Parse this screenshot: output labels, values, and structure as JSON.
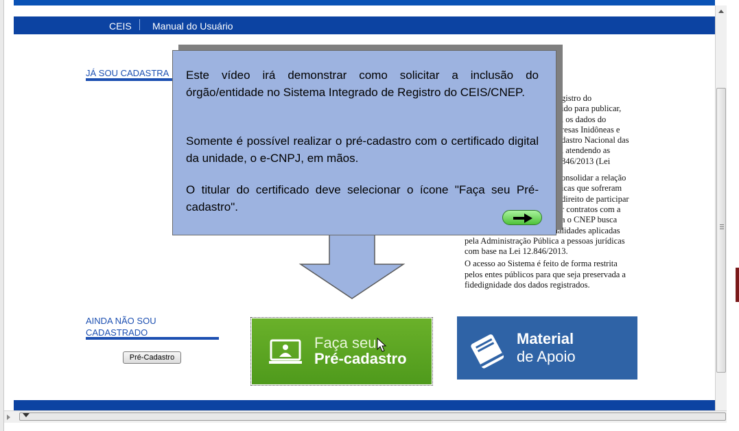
{
  "nav": {
    "item1": "CEIS",
    "item2": "Manual do Usuário"
  },
  "left": {
    "heading_registered": "JÁ SOU CADASTRA",
    "heading_not_registered_line1": "AINDA NÃO SOU",
    "heading_not_registered_line2": "CADASTRADO",
    "pre_cadastro_button": "Pré-Cadastro"
  },
  "right_column_lines": [
    "gistro do",
    "ido para publicar,",
    ", os dados do",
    "resas Inidôneas e",
    "dastro Nacional das",
    ", atendendo as",
    "846/2013 (Lei",
    "",
    "onsolidar a relação",
    "icas que sofreram",
    "direito de participar",
    "r contratos com a",
    "a o CNEP busca",
    "consolidar a relação de penalidades aplicadas",
    "pela Administração Pública a pessoas jurídicas",
    "com base na Lei 12.846/2013.",
    "O acesso ao Sistema é feito de forma restrita",
    "pelos entes públicos para que seja preservada a",
    "fidedignidade dos dados registrados."
  ],
  "tooltip": {
    "paragraph1": "Este vídeo irá demonstrar como solicitar a inclusão do órgão/entidade no Sistema Integrado de Registro do CEIS/CNEP.",
    "paragraph2": "Somente é possível realizar o pré-cadastro com o certificado digital da unidade, o e-CNPJ, em mãos.",
    "paragraph3": "O titular do certificado deve selecionar o ícone \"Faça seu Pré-cadastro\"."
  },
  "faca_button": {
    "line1": "Faça seu",
    "line2": "Pré-cadastro"
  },
  "material_button": {
    "line1": "Material",
    "line2": "de Apoio"
  },
  "icons": [
    "monitor-person-icon",
    "book-icon",
    "right-arrow-icon",
    "mouse-cursor-icon",
    "scroll-up-icon"
  ],
  "colors": {
    "nav_blue": "#0c43a2",
    "heading_blue": "#1c4fb1",
    "faca_green": "#5ea723",
    "material_blue": "#2f63a6",
    "tooltip_blue": "#9db3e0",
    "next_green": "#5fcf4a"
  }
}
